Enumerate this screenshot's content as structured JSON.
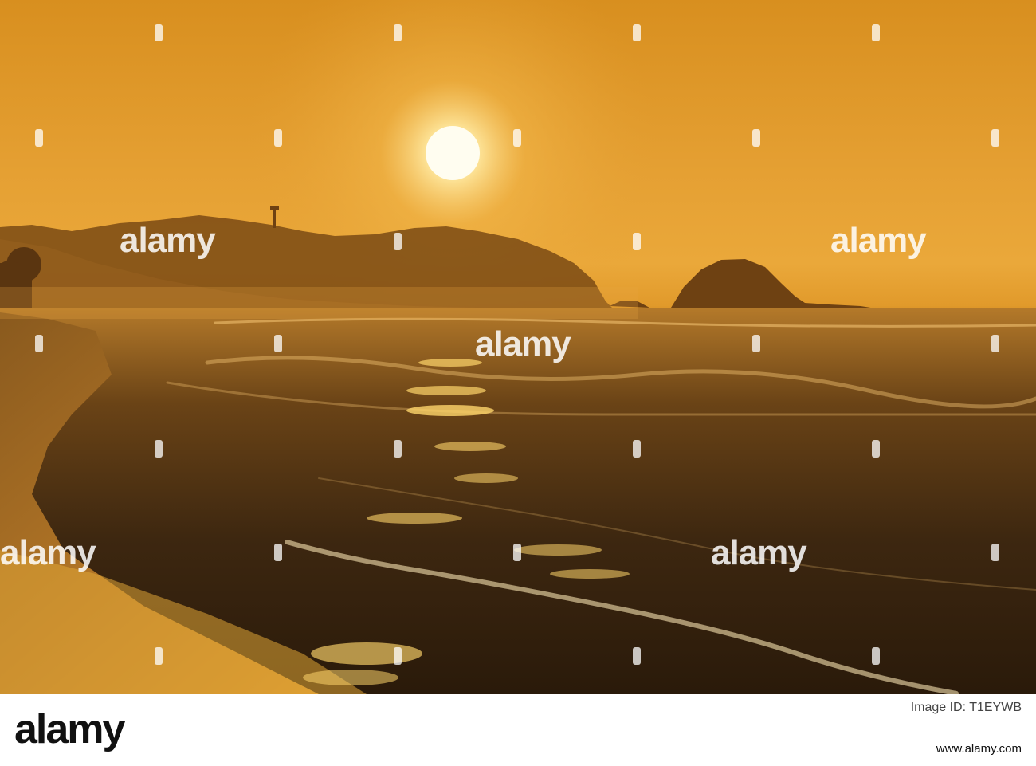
{
  "photo": {
    "description_icon": "sunset-beach-scene",
    "colors": {
      "sky": "#e5a033",
      "sun": "#fff6c8",
      "sea": "#3a2510",
      "sand": "#c98a2e"
    }
  },
  "watermark": {
    "text": "alamy"
  },
  "footer": {
    "logo": "alamy",
    "image_id_label": "Image ID: T1EYWB",
    "site": "www.alamy.com"
  }
}
